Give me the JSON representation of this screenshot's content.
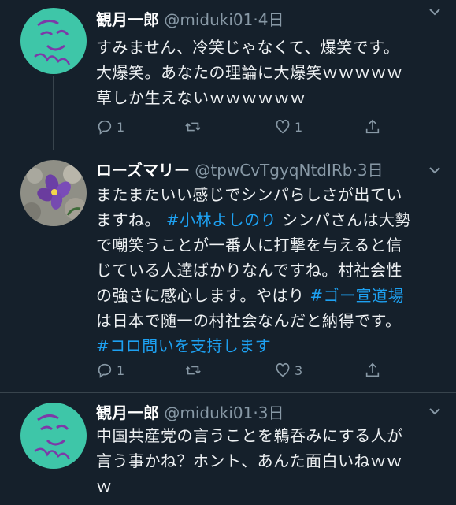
{
  "tweets": [
    {
      "name": "観月一郎",
      "handle": "@miduki01",
      "separator": "·",
      "time": "4日",
      "lines": [
        "すみません、冷笑じゃなくて、爆笑です。",
        "大爆笑。あなたの理論に大爆笑ｗｗｗｗｗ",
        "草しか生えないｗｗｗｗｗｗ"
      ],
      "replies": "1",
      "retweets": "",
      "likes": "1"
    },
    {
      "name": "ローズマリー",
      "handle": "@tpwCvTgyqNtdIRb",
      "separator": "·",
      "time": "3日",
      "line1": "またまたいい感じでシンパらしさが出てい",
      "line2_a": "ますね。 ",
      "line2_tag": "#小林よしのり",
      "line2_b": " シンパさんは大勢",
      "line3": "で嘲笑うことが一番人に打撃を与えると信",
      "line4": "じている人達ばかりなんですね。村社会性",
      "line5_a": "の強さに感心します。やはり ",
      "line5_tag": "#ゴー宣道場",
      "line6": "は日本で随一の村社会なんだと納得です。",
      "line7_tag": "#コロ問いを支持します",
      "replies": "1",
      "retweets": "",
      "likes": "3"
    },
    {
      "name": "観月一郎",
      "handle": "@miduki01",
      "separator": "·",
      "time": "3日",
      "lines": [
        "中国共産党の言うことを鵜呑みにする人が",
        "言う事かね？ホント、あんた面白いねｗｗ",
        "ｗ"
      ]
    }
  ],
  "icons": {
    "reply": "reply-icon",
    "retweet": "retweet-icon",
    "like": "heart-icon",
    "share": "share-icon",
    "caret": "chevron-down-icon"
  },
  "colors": {
    "background": "#15202b",
    "link": "#1da1f2",
    "muted": "#8899a6",
    "divider": "#38444d"
  }
}
